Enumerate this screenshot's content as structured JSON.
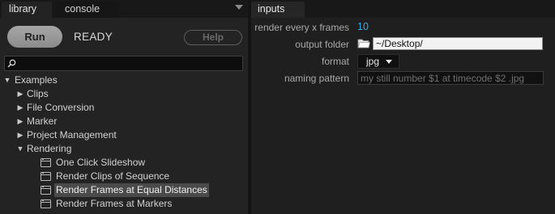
{
  "left_tabs": {
    "library": "library",
    "console": "console"
  },
  "runbar": {
    "run_label": "Run",
    "status": "READY",
    "help_label": "Help"
  },
  "search": {
    "value": "",
    "placeholder": ""
  },
  "tree": {
    "examples": "Examples",
    "clips": "Clips",
    "file_conversion": "File Conversion",
    "marker": "Marker",
    "project_management": "Project Management",
    "rendering": "Rendering",
    "rendering_items": [
      "One Click Slideshow",
      "Render Clips of Sequence",
      "Render Frames at Equal Distances",
      "Render Frames at Markers"
    ],
    "selected_item": "Render Frames at Equal Distances"
  },
  "right_tabs": {
    "inputs": "inputs"
  },
  "inputs": {
    "frames_label": "render every x frames",
    "frames_value": "10",
    "folder_label": "output folder",
    "folder_value": "~/Desktop/",
    "format_label": "format",
    "format_value": "jpg",
    "naming_label": "naming pattern",
    "naming_placeholder": "my still number $1 at timecode $2 .jpg"
  },
  "colors": {
    "accent_value": "#3ea8e0",
    "selection": "#4a4a4a"
  },
  "icons": [
    "search-icon",
    "menu-arrow-icon",
    "disclosure-triangle-icon",
    "script-file-icon",
    "folder-icon",
    "dropdown-arrow-icon"
  ]
}
